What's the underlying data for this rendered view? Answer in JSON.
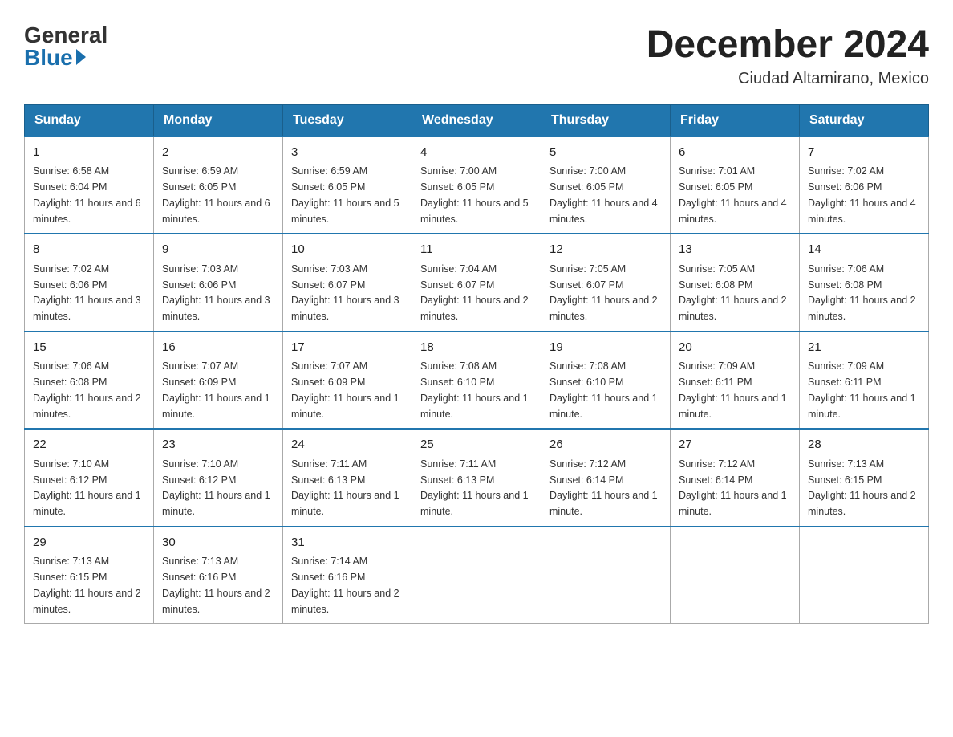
{
  "logo": {
    "general": "General",
    "blue": "Blue"
  },
  "title": "December 2024",
  "location": "Ciudad Altamirano, Mexico",
  "days_of_week": [
    "Sunday",
    "Monday",
    "Tuesday",
    "Wednesday",
    "Thursday",
    "Friday",
    "Saturday"
  ],
  "weeks": [
    [
      {
        "day": 1,
        "sunrise": "6:58 AM",
        "sunset": "6:04 PM",
        "daylight": "11 hours and 6 minutes."
      },
      {
        "day": 2,
        "sunrise": "6:59 AM",
        "sunset": "6:05 PM",
        "daylight": "11 hours and 6 minutes."
      },
      {
        "day": 3,
        "sunrise": "6:59 AM",
        "sunset": "6:05 PM",
        "daylight": "11 hours and 5 minutes."
      },
      {
        "day": 4,
        "sunrise": "7:00 AM",
        "sunset": "6:05 PM",
        "daylight": "11 hours and 5 minutes."
      },
      {
        "day": 5,
        "sunrise": "7:00 AM",
        "sunset": "6:05 PM",
        "daylight": "11 hours and 4 minutes."
      },
      {
        "day": 6,
        "sunrise": "7:01 AM",
        "sunset": "6:05 PM",
        "daylight": "11 hours and 4 minutes."
      },
      {
        "day": 7,
        "sunrise": "7:02 AM",
        "sunset": "6:06 PM",
        "daylight": "11 hours and 4 minutes."
      }
    ],
    [
      {
        "day": 8,
        "sunrise": "7:02 AM",
        "sunset": "6:06 PM",
        "daylight": "11 hours and 3 minutes."
      },
      {
        "day": 9,
        "sunrise": "7:03 AM",
        "sunset": "6:06 PM",
        "daylight": "11 hours and 3 minutes."
      },
      {
        "day": 10,
        "sunrise": "7:03 AM",
        "sunset": "6:07 PM",
        "daylight": "11 hours and 3 minutes."
      },
      {
        "day": 11,
        "sunrise": "7:04 AM",
        "sunset": "6:07 PM",
        "daylight": "11 hours and 2 minutes."
      },
      {
        "day": 12,
        "sunrise": "7:05 AM",
        "sunset": "6:07 PM",
        "daylight": "11 hours and 2 minutes."
      },
      {
        "day": 13,
        "sunrise": "7:05 AM",
        "sunset": "6:08 PM",
        "daylight": "11 hours and 2 minutes."
      },
      {
        "day": 14,
        "sunrise": "7:06 AM",
        "sunset": "6:08 PM",
        "daylight": "11 hours and 2 minutes."
      }
    ],
    [
      {
        "day": 15,
        "sunrise": "7:06 AM",
        "sunset": "6:08 PM",
        "daylight": "11 hours and 2 minutes."
      },
      {
        "day": 16,
        "sunrise": "7:07 AM",
        "sunset": "6:09 PM",
        "daylight": "11 hours and 1 minute."
      },
      {
        "day": 17,
        "sunrise": "7:07 AM",
        "sunset": "6:09 PM",
        "daylight": "11 hours and 1 minute."
      },
      {
        "day": 18,
        "sunrise": "7:08 AM",
        "sunset": "6:10 PM",
        "daylight": "11 hours and 1 minute."
      },
      {
        "day": 19,
        "sunrise": "7:08 AM",
        "sunset": "6:10 PM",
        "daylight": "11 hours and 1 minute."
      },
      {
        "day": 20,
        "sunrise": "7:09 AM",
        "sunset": "6:11 PM",
        "daylight": "11 hours and 1 minute."
      },
      {
        "day": 21,
        "sunrise": "7:09 AM",
        "sunset": "6:11 PM",
        "daylight": "11 hours and 1 minute."
      }
    ],
    [
      {
        "day": 22,
        "sunrise": "7:10 AM",
        "sunset": "6:12 PM",
        "daylight": "11 hours and 1 minute."
      },
      {
        "day": 23,
        "sunrise": "7:10 AM",
        "sunset": "6:12 PM",
        "daylight": "11 hours and 1 minute."
      },
      {
        "day": 24,
        "sunrise": "7:11 AM",
        "sunset": "6:13 PM",
        "daylight": "11 hours and 1 minute."
      },
      {
        "day": 25,
        "sunrise": "7:11 AM",
        "sunset": "6:13 PM",
        "daylight": "11 hours and 1 minute."
      },
      {
        "day": 26,
        "sunrise": "7:12 AM",
        "sunset": "6:14 PM",
        "daylight": "11 hours and 1 minute."
      },
      {
        "day": 27,
        "sunrise": "7:12 AM",
        "sunset": "6:14 PM",
        "daylight": "11 hours and 1 minute."
      },
      {
        "day": 28,
        "sunrise": "7:13 AM",
        "sunset": "6:15 PM",
        "daylight": "11 hours and 2 minutes."
      }
    ],
    [
      {
        "day": 29,
        "sunrise": "7:13 AM",
        "sunset": "6:15 PM",
        "daylight": "11 hours and 2 minutes."
      },
      {
        "day": 30,
        "sunrise": "7:13 AM",
        "sunset": "6:16 PM",
        "daylight": "11 hours and 2 minutes."
      },
      {
        "day": 31,
        "sunrise": "7:14 AM",
        "sunset": "6:16 PM",
        "daylight": "11 hours and 2 minutes."
      },
      null,
      null,
      null,
      null
    ]
  ]
}
